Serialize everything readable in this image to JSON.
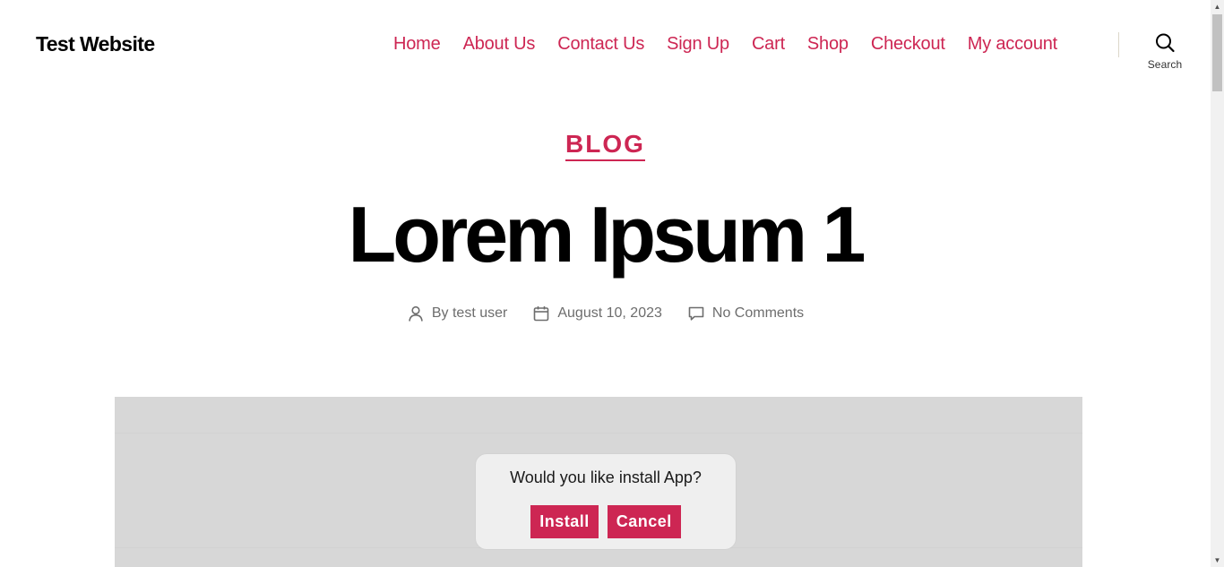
{
  "site": {
    "title": "Test Website"
  },
  "nav": {
    "items": [
      {
        "label": "Home"
      },
      {
        "label": "About Us"
      },
      {
        "label": "Contact Us"
      },
      {
        "label": "Sign Up"
      },
      {
        "label": "Cart"
      },
      {
        "label": "Shop"
      },
      {
        "label": "Checkout"
      },
      {
        "label": "My account"
      }
    ]
  },
  "search": {
    "label": "Search",
    "icon": "search-icon"
  },
  "post": {
    "category": "BLOG",
    "title": "Lorem Ipsum 1",
    "meta": {
      "author": "By test user",
      "date": "August 10, 2023",
      "comments": "No Comments"
    }
  },
  "install_dialog": {
    "message": "Would you like install App?",
    "install_label": "Install",
    "cancel_label": "Cancel"
  },
  "colors": {
    "accent": "#cd2653",
    "meta_text": "#6d6d6d",
    "featured_bg": "#d7d7d7",
    "dialog_bg": "#efefef"
  }
}
